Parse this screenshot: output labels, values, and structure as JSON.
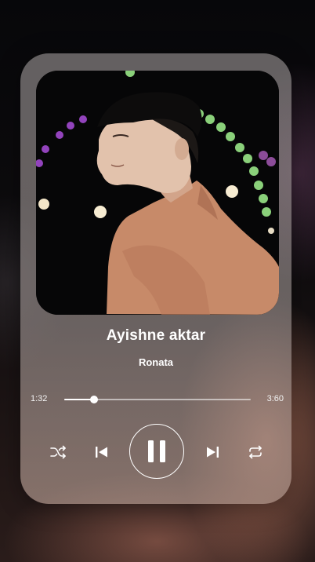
{
  "player": {
    "song_title": "Ayishne aktar",
    "artist": "Ronata",
    "elapsed": "1:32",
    "total": "3:60",
    "progress_percent": 16
  },
  "controls": {
    "shuffle_icon": "shuffle-icon",
    "previous_icon": "skip-previous-icon",
    "play_pause_icon": "pause-icon",
    "next_icon": "skip-next-icon",
    "repeat_icon": "repeat-icon"
  },
  "colors": {
    "text": "#ffffff",
    "card": "#9a9493",
    "artwork_shirt": "#c98a6a"
  }
}
